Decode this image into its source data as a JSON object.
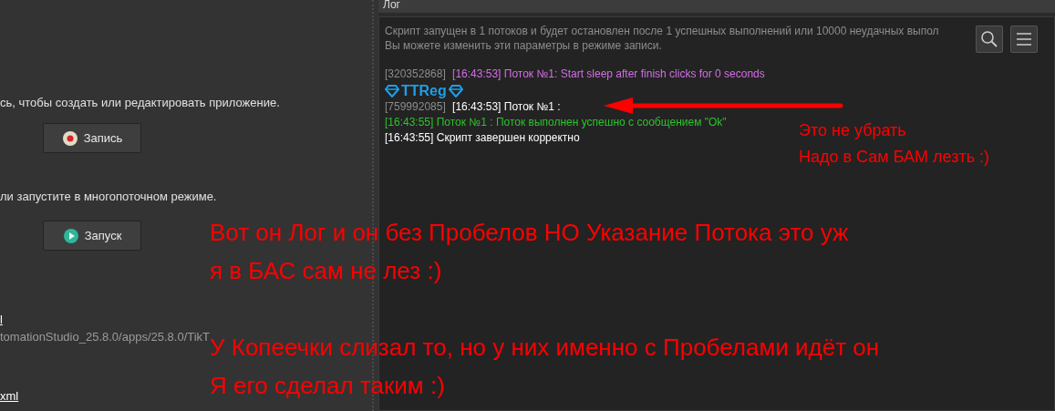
{
  "editor": {
    "record_hint": "сь, чтобы создать или редактировать приложение.",
    "record_button": "Запись",
    "run_hint": "ли запустите в многопоточном режиме.",
    "run_button": "Запуск",
    "link_1": "l",
    "path": "tomationStudio_25.8.0/apps/25.8.0/TikT",
    "link_2": "xml"
  },
  "log_panel": {
    "title": "Лог",
    "notice": [
      "Скрипт запущен в 1 потоков и будет остановлен после 1 успешных выполнений или 10000 неудачных выпол",
      "Вы можете изменить эти параметры в режиме записи."
    ],
    "lines": [
      {
        "kind": "entry",
        "id": "[320352868]",
        "text": "[16:43:53] Поток №1: Start sleep after finish clicks for 0 seconds",
        "color": "#d36ee6"
      },
      {
        "kind": "banner",
        "text": "TTReg",
        "color": "#1e9fe6"
      },
      {
        "kind": "entry",
        "id": "[759992085]",
        "text": "[16:43:53] Поток №1 :",
        "color": "#ffffff"
      },
      {
        "kind": "entry",
        "text": "[16:43:55] Поток №1 : Поток выполнен успешно с сообщением \"Ok\"",
        "color": "#2bc42b"
      },
      {
        "kind": "entry",
        "text": "[16:43:55] Скрипт завершен корректно",
        "color": "#ffffff"
      }
    ]
  },
  "annotations": {
    "small": [
      "Это не убрать",
      "Надо в Сам БАМ лезть :)"
    ],
    "large": [
      "Вот он Лог и он без Пробелов НО Указание Потока это уж",
      "я в БАС сам не лез :)",
      "У Копеечки слизал то, но у них именно с Пробелами идёт он",
      "Я его сделал таким :)"
    ]
  }
}
